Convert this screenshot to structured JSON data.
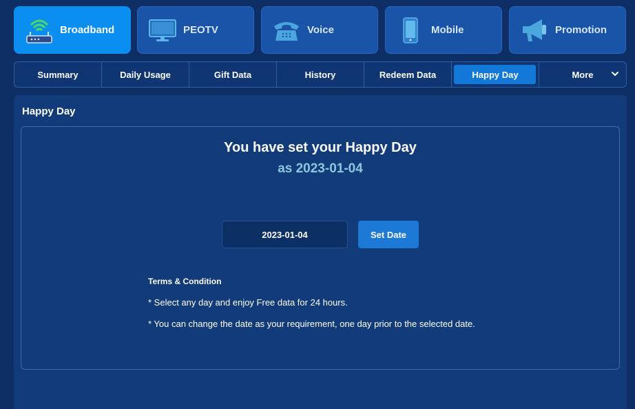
{
  "services": [
    {
      "label": "Broadband",
      "icon": "router-icon",
      "active": true
    },
    {
      "label": "PEOTV",
      "icon": "tv-icon",
      "active": false
    },
    {
      "label": "Voice",
      "icon": "telephone-icon",
      "active": false
    },
    {
      "label": "Mobile",
      "icon": "mobile-phone-icon",
      "active": false
    },
    {
      "label": "Promotion",
      "icon": "megaphone-icon",
      "active": false
    }
  ],
  "sub_tabs": [
    {
      "label": "Summary"
    },
    {
      "label": "Daily Usage"
    },
    {
      "label": "Gift Data"
    },
    {
      "label": "History"
    },
    {
      "label": "Redeem Data"
    },
    {
      "label": "Happy Day",
      "active": true
    },
    {
      "label": "More"
    }
  ],
  "panel": {
    "title": "Happy Day",
    "heading": "You have set your Happy Day",
    "subheading": "as 2023-01-04",
    "date_value": "2023-01-04",
    "set_button": "Set Date",
    "terms_title": "Terms & Condition",
    "terms": [
      "*  Select any day and enjoy Free data for 24 hours.",
      "*  You can change the date as your requirement, one day prior to the selected date."
    ]
  },
  "colors": {
    "background": "#0d2f66",
    "active_tab": "#0a8ef0",
    "tab": "#1a54a8",
    "button": "#1e78d6",
    "accent_text": "#8cc7e0"
  }
}
